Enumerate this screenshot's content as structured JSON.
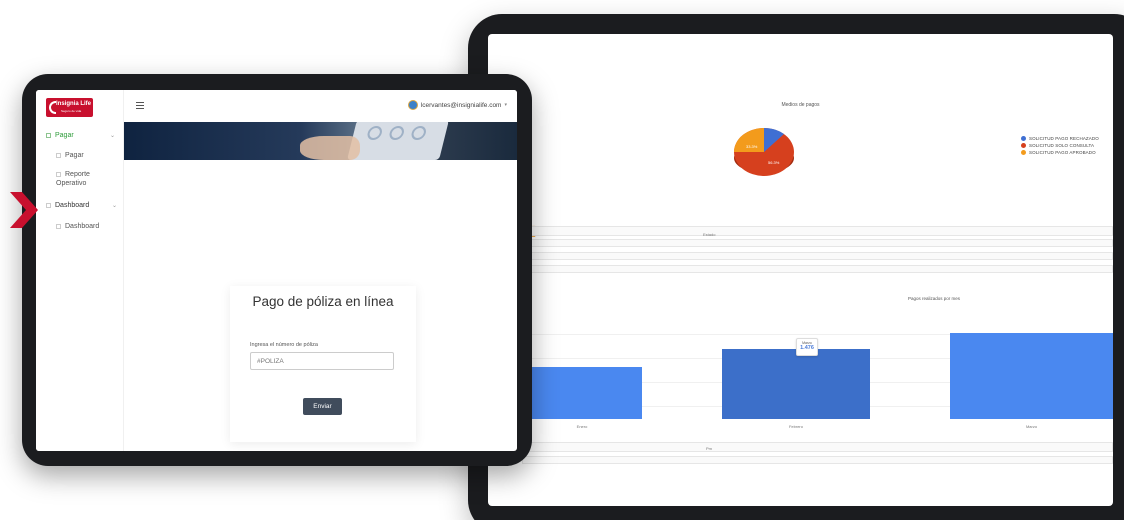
{
  "colors": {
    "brand_red": "#c8102e",
    "slice_blue": "#3f6fd3",
    "slice_red": "#d6401e",
    "slice_orange": "#f39b1c",
    "bar_blue": "#4a88f0",
    "bar_blue_active": "#3c6fc9",
    "button_dark": "#404c5c"
  },
  "back_tablet": {
    "pie_title": "Medios de pagos",
    "legend": [
      {
        "label": "SOLICITUD PAGO RECHAZADO",
        "color": "#3f6fd3"
      },
      {
        "label": "SOLICITUD SOLO CONSULTA",
        "color": "#d6401e"
      },
      {
        "label": "SOLICITUD PAGO APROBADO",
        "color": "#f39b1c"
      }
    ],
    "pie_slice_labels": {
      "red": "56.3%",
      "orange": "33.3%"
    },
    "table_label": "Estado",
    "bar_title": "Pagos realizados por mes",
    "tooltip": {
      "name": "Marzo",
      "value": "1.476"
    },
    "footer_label": "Pm"
  },
  "chart_data": {
    "type": "bar",
    "title": "Pagos realizados por mes",
    "categories": [
      "Enero",
      "Febrero",
      "Marzo"
    ],
    "values": [
      1100,
      1476,
      1820
    ],
    "ylim": [
      0,
      2000
    ]
  },
  "front_tablet": {
    "logo": {
      "name": "Insignia Life",
      "tagline": "Seguro de vida"
    },
    "sidebar": {
      "items": [
        {
          "label": "Pagar",
          "level": 0,
          "icon": "cash-icon",
          "active": true
        },
        {
          "label": "Pagar",
          "level": 1,
          "icon": "card-icon"
        },
        {
          "label": "Reporte Operativo",
          "level": 1,
          "icon": "file-icon"
        },
        {
          "label": "Dashboard",
          "level": 0,
          "icon": "dashboard-icon"
        },
        {
          "label": "Dashboard",
          "level": 1,
          "icon": "chart-icon"
        }
      ]
    },
    "topbar": {
      "user_email": "lcervantes@insignialife.com",
      "user_caret": "▾"
    },
    "form": {
      "title": "Pago de póliza en línea",
      "label": "Ingresa el número de póliza",
      "placeholder": "#POLIZA",
      "submit_label": "Enviar"
    }
  }
}
